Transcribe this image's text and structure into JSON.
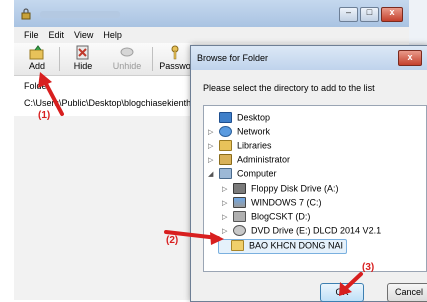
{
  "menubar": [
    "File",
    "Edit",
    "View",
    "Help"
  ],
  "toolbar": {
    "add": "Add",
    "hide": "Hide",
    "unhide": "Unhide",
    "password": "Passwo"
  },
  "left_panel": {
    "folder_label": "Folde",
    "path": "C:\\Users\\Public\\Desktop\\blogchiasekienthu"
  },
  "dialog": {
    "title": "Browse for Folder",
    "prompt": "Please select the directory to add to the list",
    "tree": [
      {
        "label": "Desktop",
        "icon": "desktop-icon"
      },
      {
        "label": "Network",
        "icon": "network-icon"
      },
      {
        "label": "Libraries",
        "icon": "libraries-icon"
      },
      {
        "label": "Administrator",
        "icon": "user-folder-icon"
      },
      {
        "label": "Computer",
        "icon": "computer-icon"
      },
      {
        "label": "Floppy Disk Drive (A:)",
        "icon": "floppy-drive-icon"
      },
      {
        "label": "WINDOWS 7 (C:)",
        "icon": "hard-drive-icon"
      },
      {
        "label": "BlogCSKT (D:)",
        "icon": "hard-drive-icon"
      },
      {
        "label": "DVD Drive (E:) DLCD 2014 V2.1",
        "icon": "dvd-drive-icon"
      },
      {
        "label": "BAO KHCN DONG NAI",
        "icon": "folder-icon"
      }
    ],
    "ok": "OK",
    "cancel": "Cancel"
  },
  "annotations": {
    "a1": "(1)",
    "a2": "(2)",
    "a3": "(3)"
  },
  "colors": {
    "annotation": "#d81f1f",
    "selection": "#e5f1fb"
  }
}
